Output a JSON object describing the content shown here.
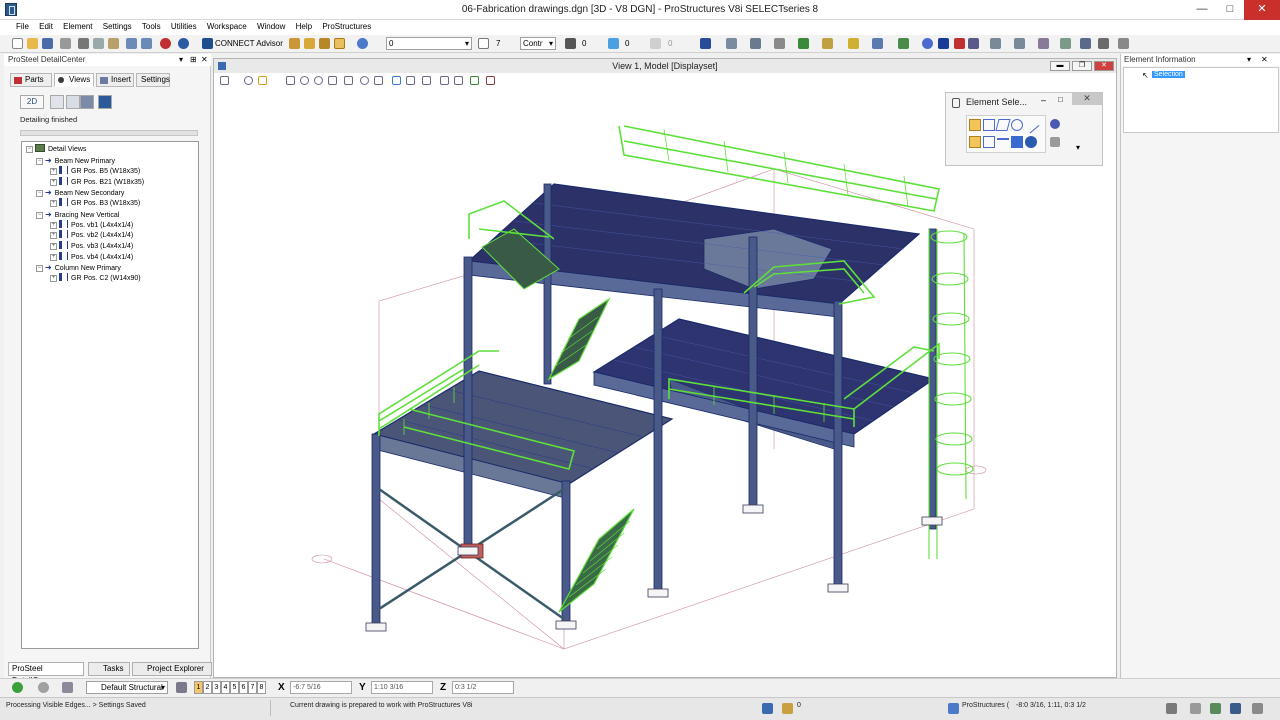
{
  "window": {
    "title": "06-Fabrication drawings.dgn [3D - V8 DGN] - ProStructures V8i SELECTseries 8",
    "controls": {
      "min": "—",
      "max": "□",
      "close": "✕"
    }
  },
  "menu": [
    "File",
    "Edit",
    "Element",
    "Settings",
    "Tools",
    "Utilities",
    "Workspace",
    "Window",
    "Help",
    "ProStructures"
  ],
  "toolbar": {
    "connect_advisor": "CONNECT Advisor",
    "level_value": "0",
    "weight_value": "7",
    "style_value": "Contr",
    "line_value": "0",
    "color_value": "0",
    "trans_value": "0"
  },
  "left_panel": {
    "title": "ProSteel DetailCenter",
    "header_controls": [
      "▾",
      "⊞",
      "✕"
    ],
    "tabs": [
      "Parts",
      "Views",
      "Insert",
      "Settings"
    ],
    "btn_2d": "2D",
    "status": "Detailing finished",
    "tree": {
      "root": "Detail Views",
      "groups": [
        {
          "label": "Beam New Primary",
          "items": [
            "GR Pos. B5 (W18x35)",
            "GR Pos. B21 (W18x35)"
          ]
        },
        {
          "label": "Beam New Secondary",
          "items": [
            "GR Pos. B3 (W18x35)"
          ]
        },
        {
          "label": "Bracing New Vertical",
          "items": [
            "Pos. vb1 (L4x4x1/4)",
            "Pos. vb2 (L4x4x1/4)",
            "Pos. vb3 (L4x4x1/4)",
            "Pos. vb4 (L4x4x1/4)"
          ]
        },
        {
          "label": "Column New Primary",
          "items": [
            "GR Pos. C2 (W14x90)"
          ]
        }
      ]
    },
    "bottom_tabs": [
      "ProSteel DetailCe...",
      "Tasks",
      "Project Explorer"
    ]
  },
  "view": {
    "title": "View 1, Model [Displayset]",
    "controls": [
      "▬",
      "❐",
      "✕"
    ]
  },
  "element_selection": {
    "title": "Element Sele...",
    "controls": [
      "–",
      "□",
      "✕"
    ]
  },
  "right_panel": {
    "title": "Element Information",
    "header_controls": [
      "▾",
      "✕"
    ],
    "selection": "Selection"
  },
  "bottom_bar": {
    "view_group": "Default Structural",
    "view_numbers": [
      "1",
      "2",
      "3",
      "4",
      "5",
      "6",
      "7",
      "8"
    ],
    "x_label": "X",
    "x_value": "-6:7 5/16",
    "y_label": "Y",
    "y_value": "1:10 3/16",
    "z_label": "Z",
    "z_value": "0:3 1/2"
  },
  "status_bar": {
    "left": "Processing Visible Edges... > Settings Saved",
    "message": "Current drawing is prepared to work with ProStructures V8i",
    "zero": "0",
    "app": "ProStructures (",
    "coords": "-8:0 3/16, 1:11, 0:3 1/2"
  },
  "colors": {
    "steel": "#3a4a78",
    "railing": "#5ee03a",
    "grating": "#2a2e6a",
    "accent": "#3399ff"
  }
}
